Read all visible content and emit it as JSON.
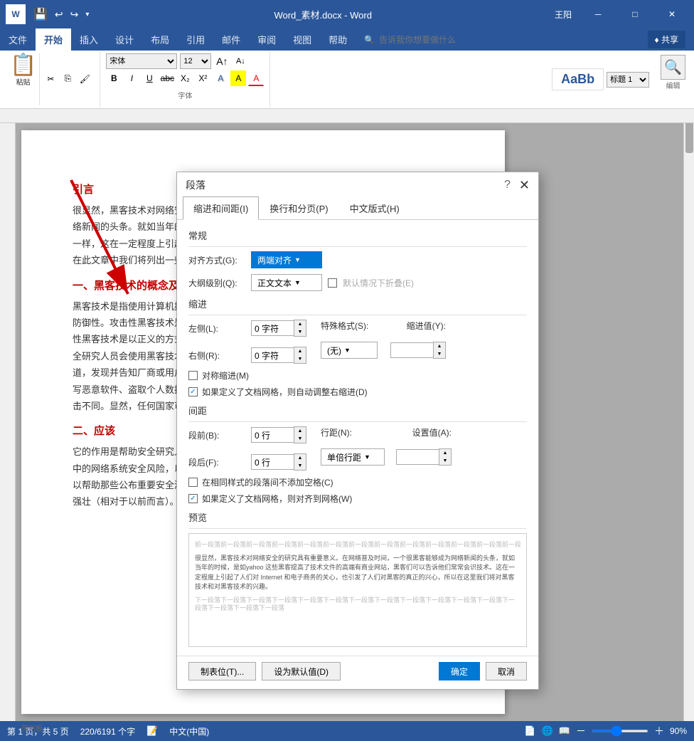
{
  "app": {
    "title": "Word_素材.docx - Word",
    "user": "王阳"
  },
  "titlebar": {
    "quickaccess": [
      "💾",
      "↩",
      "↪",
      "▾"
    ],
    "window_btns": [
      "－",
      "□",
      "✕"
    ]
  },
  "ribbon": {
    "tabs": [
      "文件",
      "开始",
      "插入",
      "设计",
      "布局",
      "引用",
      "邮件",
      "审阅",
      "视图",
      "帮助"
    ],
    "active_tab": "开始",
    "search_placeholder": "告诉我你想要做什么",
    "share_label": "♦ 共享",
    "groups": {
      "clipboard": "剪贴板",
      "font": "字体"
    }
  },
  "document": {
    "section1_title": "引言",
    "section1_text1": "很显然，黑客技术对网络安全的研究具有重要意义。在网络普及时间，一个很黑客能够成为网络新闻的头条。就如当年的时候，是如 yahoo，ebay，amazon，CNN等大型企业网站被攻击一样，这在一定程度上引起了人们对 Internet 和电子商务的关心。和对黑客技术的兴趣，所以在此文章中我们将列出一些对黑客技术的个人看法，",
    "section2_title": "一、黑客技术的概念及其分类",
    "section2_text": "黑客技术是指使用计算机技术进行攻击和入侵行为的方法和手段。黑客技术既有攻击性，也有防御性。攻击性黑客技术是指通过对目标系统进行入侵从而获取他们的产品系统的权限；防御性黑客技术是以正义的方式展示网络系统的破坏力而来促使人们改进安全系统。比如，一些安全研究人员会使用黑客技术将其弃于科学研究或改进社会的安全状况；一些黑客通过安全渠道，发现并告知厂商或用户软件中的安全漏洞，这也是一个道德写，这和一些不道德的黑客会写恶意软件、盗取个人数据、攻击政府网站或使用别人已被攻击的计算机发动大规模的网络攻击不同。显然，任何国家可以立法打击网络犯罪，但这并不能阻止黑客攻击的发生。",
    "section3_title": "二、应该",
    "section3_text": "它的作用是帮助安全研究人员、网络管理员以及其他安全专业人员了解和减少网络和网络漏洞中的网络系统安全风险，以防止未经授权的访问，数据丢失和网络意安全。研究黑客技术还可以帮助那些公布重要安全漏洞的研究人员，了解安全的本质，以便那些公布重不会有今天这久强壮（相对于以前而言）。"
  },
  "statusbar": {
    "page_info": "第 1 页，共 5 页",
    "word_count": "220/6191 个字",
    "lang": "中文(中国)",
    "zoom": "90%"
  },
  "dialog": {
    "title": "段落",
    "help_symbol": "?",
    "close_symbol": "✕",
    "tabs": [
      "缩进和间距(I)",
      "换行和分页(P)",
      "中文版式(H)"
    ],
    "active_tab": "缩进和间距(I)",
    "sections": {
      "general": {
        "label": "常规",
        "alignment_label": "对齐方式(G):",
        "alignment_value": "两端对齐",
        "outline_label": "大纲级别(Q):",
        "outline_value": "正文文本",
        "collapse_label": "默认情况下折叠(E)"
      },
      "indent": {
        "label": "缩进",
        "left_label": "左侧(L):",
        "left_value": "0 字符",
        "right_label": "右侧(R):",
        "right_value": "0 字符",
        "special_label": "特殊格式(S):",
        "special_value": "(无)",
        "indent_value_label": "缩进值(Y):",
        "symmetric_label": "对称缩进(M)",
        "auto_adjust_label": "如果定义了文档网格，则自动调整右缩进(D)"
      },
      "spacing": {
        "label": "间距",
        "before_label": "段前(B):",
        "before_value": "0 行",
        "after_label": "段后(F):",
        "after_value": "0 行",
        "line_spacing_label": "行距(N):",
        "line_spacing_value": "单倍行距",
        "set_value_label": "设置值(A):",
        "no_space_label": "在相同样式的段落间不添加空格(C)",
        "grid_align_label": "如果定义了文档网格，则对齐到网格(W)"
      },
      "preview": {
        "label": "预览",
        "gray_lines": "前一段落前一段落前一段落前一段落前一段落前一段落前一段落前一段落前一段落前一段落前一段落前一段落前一段落前一段落前一段落前一段落",
        "main_text": "很显然，黑客技术对网络安全的研究具有重要意义。在网络普及时间，一个很黑客能够成为网络新闻的头条，就如当年的时候，是如yahoo 这些黑客提高了技术文件的高端有商业网站，黑客们可以告诉他们常常会识技术。这在一定程度上引起了人们对 Internet 和电子商务的关心，也引发了人们对黑客的真正的兴心，所以在这里我们将对黑客技术和对黑客技术的兴趣。",
        "gray_lines2": "下一段落下一段落下一段落下一段落下一段落下一段落下一段落下一段落下一段落下一段落下一段落下一段落下一段落下一段落下一段落下一段落"
      }
    },
    "footer": {
      "tab_btn": "制表位(T)...",
      "default_btn": "设为默认值(D)",
      "ok_btn": "确定",
      "cancel_btn": "取消"
    }
  }
}
